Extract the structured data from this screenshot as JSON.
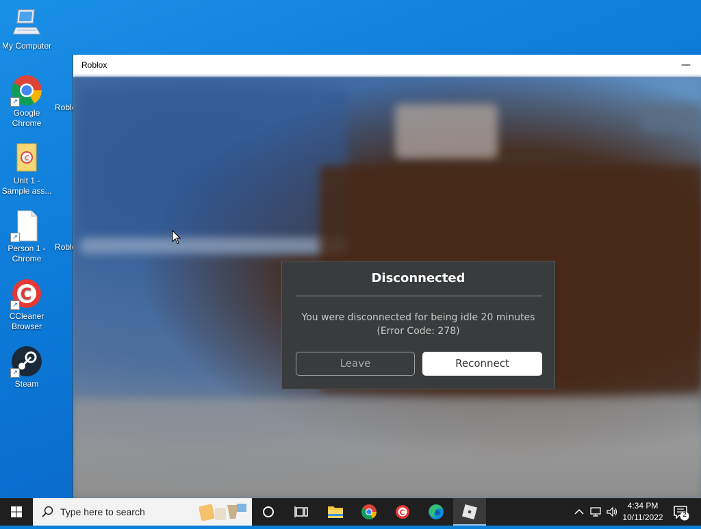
{
  "desktop": {
    "icons": [
      {
        "label": "My Computer"
      },
      {
        "label": "Google Chrome"
      },
      {
        "label": "Unit 1 - Sample ass..."
      },
      {
        "label": "Person 1 - Chrome"
      },
      {
        "label": "CCleaner Browser"
      },
      {
        "label": "Steam"
      }
    ],
    "partial_icons": [
      {
        "label": "Roblo"
      },
      {
        "label": "Roblo"
      }
    ]
  },
  "window": {
    "title": "Roblox",
    "minimize_glyph": "—"
  },
  "dialog": {
    "title": "Disconnected",
    "message_line1": "You were disconnected for being idle 20 minutes",
    "message_line2": "(Error Code: 278)",
    "leave_label": "Leave",
    "reconnect_label": "Reconnect"
  },
  "taskbar": {
    "search_placeholder": "Type here to search",
    "pinned": [
      {
        "name": "cortana-icon"
      },
      {
        "name": "task-view-icon"
      },
      {
        "name": "file-explorer-icon"
      },
      {
        "name": "chrome-icon"
      },
      {
        "name": "ccleaner-icon"
      },
      {
        "name": "edge-icon"
      },
      {
        "name": "roblox-icon"
      }
    ],
    "clock": {
      "time": "4:34 PM",
      "date": "10/11/2022"
    },
    "notification_count": "2"
  },
  "colors": {
    "desktop_blue": "#0b78d6",
    "dialog_bg": "#393b3d",
    "taskbar_bg": "#1f1f1f"
  }
}
